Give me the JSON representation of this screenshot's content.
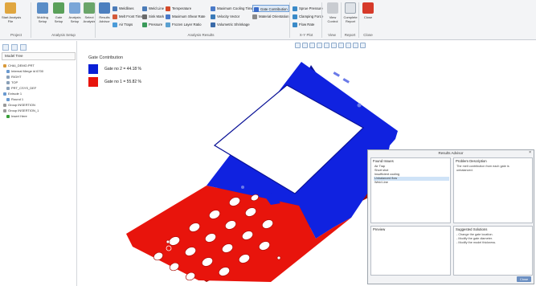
{
  "ribbon": {
    "buttons": [
      {
        "label": "Start Analysis\nFile",
        "icon": "folder-run-icon",
        "color": "#e0a640"
      },
      {
        "label": "Molding\nSetup",
        "icon": "mold-setup-icon",
        "color": "#5a8dc7"
      },
      {
        "label": "Gate\nSetup",
        "icon": "gate-setup-icon",
        "color": "#5aa05a"
      },
      {
        "label": "Analysis\nSetup",
        "icon": "analysis-setup-icon",
        "color": "#7aa6d8"
      },
      {
        "label": "Select\nAnalysis",
        "icon": "select-analysis-icon",
        "color": "#6aa56a"
      },
      {
        "label": "Results\nAdvisor",
        "icon": "results-advisor-icon",
        "color": "#4c7fbf"
      }
    ],
    "results_items": [
      "Weldlines",
      "Melt Front Time",
      "Air Traps",
      "Weld Line",
      "Sink Mark",
      "Pressure",
      "Temperature",
      "Maximum Shear Rate",
      "Frozen Layer Ratio",
      "Maximum Cooling Time",
      "Velocity Vector",
      "Volumetric Shrinkage",
      "Gate Contribution",
      "Material Orientation"
    ],
    "xy_items": [
      "Sprue Pressure",
      "Clamping Force",
      "Flow Rate"
    ],
    "view_label": "View\nControl",
    "report_label": "Complete\nReport",
    "close_label": "Close",
    "group_labels": [
      "Project",
      "Analysis Setup",
      "Analysis Results",
      "X-Y Plot",
      "View",
      "Report",
      "Close"
    ]
  },
  "left_panel": {
    "tree_title": "Model Tree",
    "tree_items": [
      "CHAI_DEMO.PRT",
      "Internal Merge id 6700",
      "RIGHT",
      "TOP",
      "PRT_CSYS_DEF",
      "Extrude 1",
      "Round 1",
      "Group INSERTION",
      "Group INSERTION_1",
      "Insert Here"
    ]
  },
  "legend": {
    "title": "Gate Contribution",
    "entries": [
      {
        "label": "Gate no 2 = 44.18 %",
        "color": "#0a1fd6"
      },
      {
        "label": "Gate no 1 = 55.82 %",
        "color": "#e8140c"
      }
    ]
  },
  "advisor": {
    "title": "Results Advisor",
    "found_issues_title": "Found Issues",
    "issues": [
      "Air Trap",
      "Short shot",
      "Insufficient cooling",
      "Unbalanced flow",
      "Weld Line"
    ],
    "selected_issue": 3,
    "problem_title": "Problem Description",
    "problem_text": [
      "The melt contribution from each gate is",
      "unbalanced."
    ],
    "preview_title": "Preview",
    "solutions_title": "Suggested Solutions",
    "solutions": [
      "- Change the gate location.",
      "- Modify the gate diameter.",
      "- Modify the model thickness."
    ],
    "close_label": "Close"
  }
}
